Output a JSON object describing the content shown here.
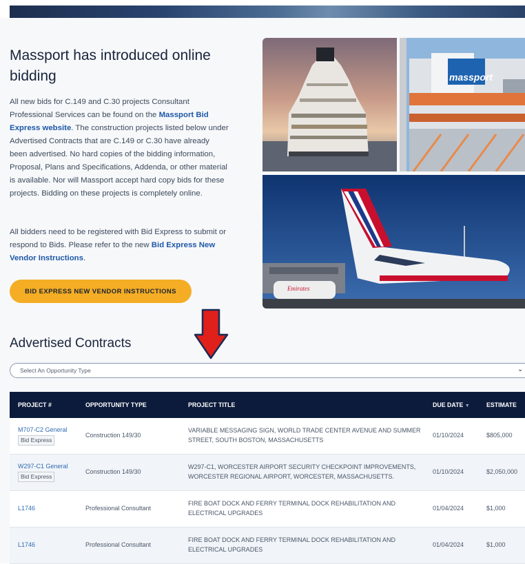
{
  "intro": {
    "title": "Massport has introduced online bidding",
    "p1_before": "All new bids for C.149 and C.30 projects Consultant Professional Services can be found on the ",
    "p1_link": "Massport Bid Express website",
    "p1_after": ". The construction projects listed below under Advertised Contracts that are C.149 or C.30 have already been advertised. No hard copies of the bidding information, Proposal, Plans and Specifications, Addenda, or other material is available. Nor will Massport accept hard copy bids for these projects. Bidding on these projects is completely online.",
    "p2_before": "All bidders need to be registered with Bid Express to submit or respond to Bids. Please refer to the new ",
    "p2_link": "Bid Express New Vendor Instructions",
    "p2_after": ".",
    "cta_label": "BID EXPRESS NEW VENDOR INSTRUCTIONS"
  },
  "images": {
    "building_sign": "massport",
    "plane_livery": "Emirates"
  },
  "contracts": {
    "title": "Advertised Contracts",
    "select_placeholder": "Select An Opportunity Type",
    "columns": {
      "project": "PROJECT #",
      "type": "OPPORTUNITY TYPE",
      "title": "PROJECT TITLE",
      "due": "DUE DATE",
      "due_sort_icon": "▼",
      "estimate": "ESTIMATE"
    },
    "rows": [
      {
        "project": "M707-C2 General",
        "badge": "Bid Express",
        "type": "Construction 149/30",
        "title": "VARIABLE MESSAGING SIGN, WORLD TRADE CENTER AVENUE AND SUMMER STREET, SOUTH BOSTON, MASSACHUSETTS",
        "due": "01/10/2024",
        "estimate": "$805,000"
      },
      {
        "project": "W297-C1 General",
        "badge": "Bid Express",
        "type": "Construction 149/30",
        "title": "W297-C1, WORCESTER AIRPORT SECURITY CHECKPOINT IMPROVEMENTS, WORCESTER REGIONAL AIRPORT, WORCESTER, MASSACHUSETTS.",
        "due": "01/10/2024",
        "estimate": "$2,050,000"
      },
      {
        "project": "L1746",
        "badge": "",
        "type": "Professional Consultant",
        "title": "FIRE BOAT DOCK AND FERRY TERMINAL DOCK REHABILITATION AND ELECTRICAL UPGRADES",
        "due": "01/04/2024",
        "estimate": "$1,000"
      },
      {
        "project": "L1746",
        "badge": "",
        "type": "Professional Consultant",
        "title": "FIRE BOAT DOCK AND FERRY TERMINAL DOCK REHABILITATION AND ELECTRICAL UPGRADES",
        "due": "01/04/2024",
        "estimate": "$1,000"
      }
    ]
  },
  "colors": {
    "accent": "#f4ad24",
    "header_bg": "#0c1b3b",
    "link": "#2f6bb3",
    "arrow": "#e0201b"
  }
}
